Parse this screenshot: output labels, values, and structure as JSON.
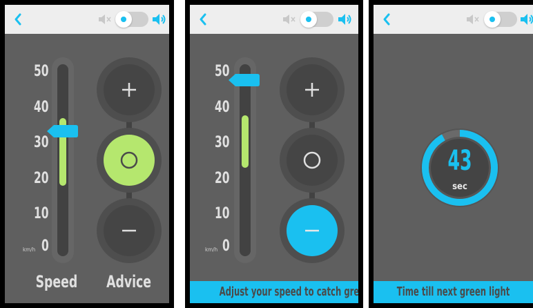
{
  "colors": {
    "accent": "#1ac0f0",
    "green": "#b5e76e",
    "background": "#5f5f5f",
    "topbar": "#eeeeee"
  },
  "topbar": {
    "back_icon": "chevron-left-icon",
    "mute_icon": "speaker-muted-icon",
    "sound_icon": "speaker-on-icon"
  },
  "speed_scale": {
    "unit": "km/h",
    "ticks": [
      "50",
      "40",
      "30",
      "20",
      "10",
      "0"
    ]
  },
  "screens": [
    {
      "name": "speed-advice",
      "current_speed_kmh": 30,
      "recommended_range_kmh": [
        20,
        36
      ],
      "active_advice": "hold",
      "labels": {
        "left": "Speed",
        "right": "Advice"
      },
      "buttons": [
        {
          "symbol": "+",
          "icon": "plus-icon"
        },
        {
          "symbol": "○",
          "icon": "circle-icon"
        },
        {
          "symbol": "−",
          "icon": "minus-icon"
        }
      ]
    },
    {
      "name": "adjust-speed",
      "current_speed_kmh": 48,
      "recommended_range_kmh": [
        22,
        36
      ],
      "active_advice": "slow-down",
      "caption": "Adjust your speed to catch green"
    },
    {
      "name": "green-light-timer",
      "timer_value": "43",
      "timer_unit": "sec",
      "timer_progress": 0.92,
      "caption": "Time till next green light"
    }
  ]
}
